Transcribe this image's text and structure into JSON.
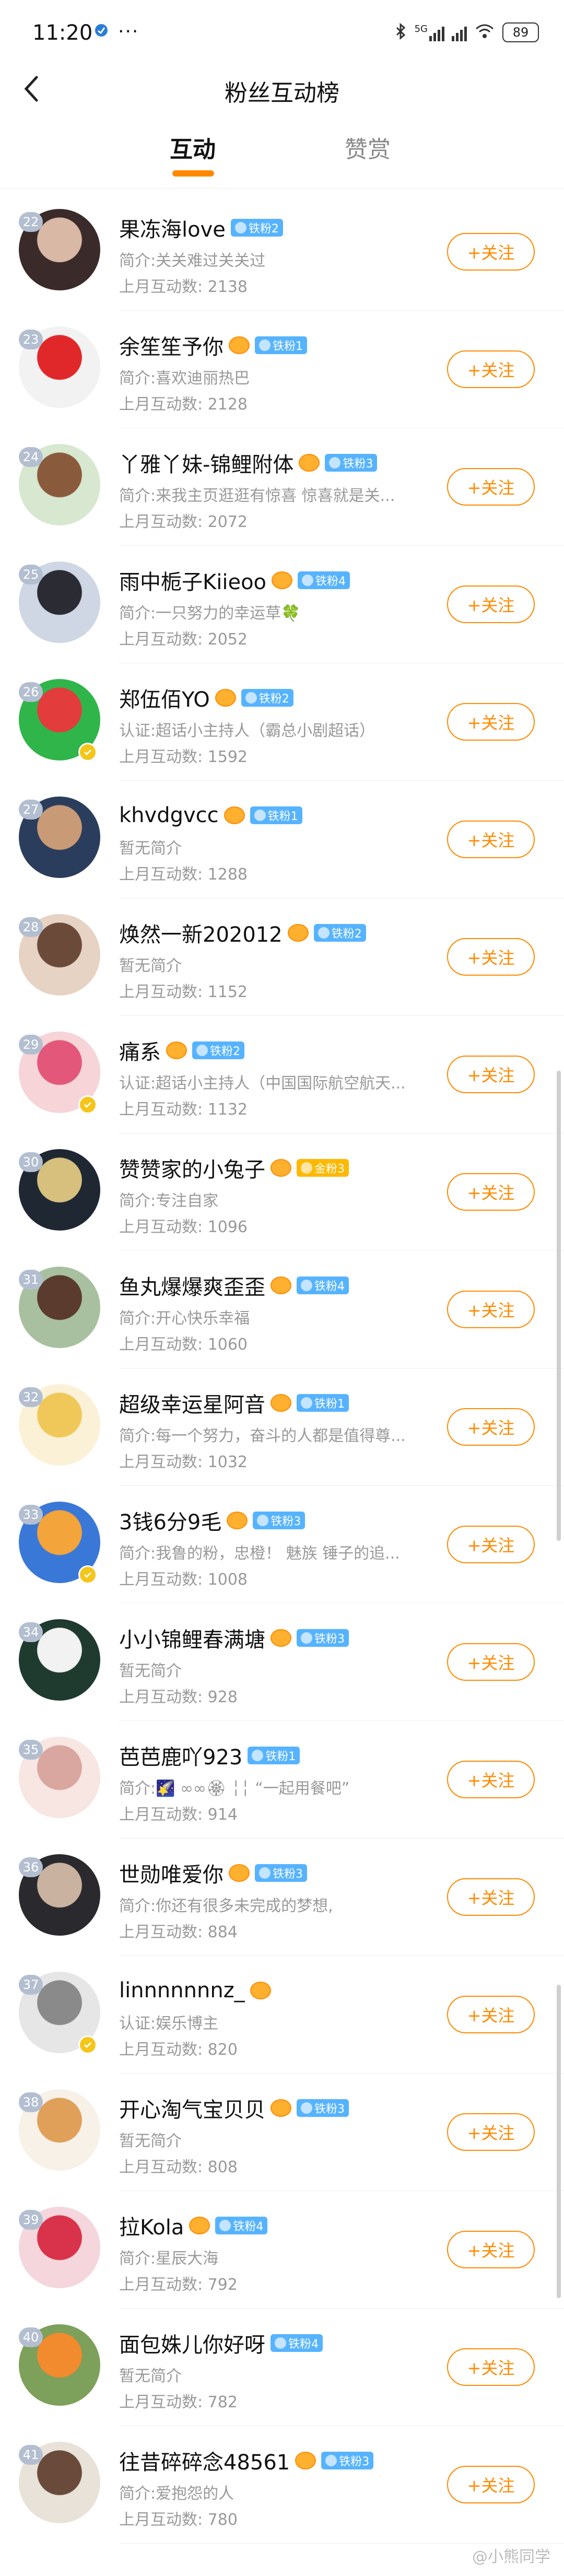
{
  "status_bar": {
    "time": "11:20",
    "dots": "···",
    "battery": "89",
    "network": "5G"
  },
  "header": {
    "title": "粉丝互动榜",
    "back_icon": "chevron-left-icon"
  },
  "tabs": [
    {
      "label": "互动",
      "active": true
    },
    {
      "label": "赞赏",
      "active": false
    }
  ],
  "follow_label": "+关注",
  "fans": [
    {
      "rank": "22",
      "name": "果冻海love",
      "badge": "铁粉2",
      "badge_color": "blue",
      "crown": false,
      "intro": "简介:关关难过关关过",
      "count": "上月互动数: 2138",
      "avatar": [
        "#3a2a2a",
        "#d9b8a6"
      ],
      "verified": false
    },
    {
      "rank": "23",
      "name": "余笙笙予你",
      "badge": "铁粉1",
      "badge_color": "blue",
      "crown": true,
      "intro": "简介:喜欢迪丽热巴",
      "count": "上月互动数: 2128",
      "avatar": [
        "#f2f2f2",
        "#e0282b"
      ],
      "verified": false
    },
    {
      "rank": "24",
      "name": "丫雅丫妹-锦鲤附体",
      "badge": "铁粉3",
      "badge_color": "blue",
      "crown": true,
      "intro": "简介:来我主页逛逛有惊喜 惊喜就是关...",
      "count": "上月互动数: 2072",
      "avatar": [
        "#d7e7d0",
        "#8a5a3c"
      ],
      "verified": false
    },
    {
      "rank": "25",
      "name": "雨中栀子Kiieoo",
      "badge": "铁粉4",
      "badge_color": "blue",
      "crown": true,
      "intro": "简介:一只努力的幸运草🍀",
      "count": "上月互动数: 2052",
      "avatar": [
        "#cfd6e4",
        "#2b2b33"
      ],
      "verified": false
    },
    {
      "rank": "26",
      "name": "郑伍佰YO",
      "badge": "铁粉2",
      "badge_color": "blue",
      "crown": true,
      "intro": "认证:超话小主持人（霸总小剧超话）",
      "count": "上月互动数: 1592",
      "avatar": [
        "#2fb54a",
        "#e23c3c"
      ],
      "verified": true
    },
    {
      "rank": "27",
      "name": "khvdgvcc",
      "badge": "铁粉1",
      "badge_color": "blue",
      "crown": true,
      "intro": "暂无简介",
      "count": "上月互动数: 1288",
      "avatar": [
        "#2b3d5c",
        "#c99a76"
      ],
      "verified": false
    },
    {
      "rank": "28",
      "name": "焕然一新202012",
      "badge": "铁粉2",
      "badge_color": "blue",
      "crown": true,
      "intro": "暂无简介",
      "count": "上月互动数: 1152",
      "avatar": [
        "#e6d3c4",
        "#6b4a3a"
      ],
      "verified": false
    },
    {
      "rank": "29",
      "name": "痛系",
      "badge": "铁粉2",
      "badge_color": "blue",
      "crown": true,
      "intro": "认证:超话小主持人（中国国际航空航天...",
      "count": "上月互动数: 1132",
      "avatar": [
        "#f6d4d8",
        "#e2577a"
      ],
      "verified": true
    },
    {
      "rank": "30",
      "name": "赞赞家的小兔子",
      "badge": "金粉3",
      "badge_color": "gold",
      "crown": true,
      "intro": "简介:专注自家",
      "count": "上月互动数: 1096",
      "avatar": [
        "#1f2733",
        "#d7c07e"
      ],
      "verified": false
    },
    {
      "rank": "31",
      "name": "鱼丸爆爆爽歪歪",
      "badge": "铁粉4",
      "badge_color": "blue",
      "crown": true,
      "intro": "简介:开心快乐幸福",
      "count": "上月互动数: 1060",
      "avatar": [
        "#a8c0a0",
        "#5a3b2e"
      ],
      "verified": false
    },
    {
      "rank": "32",
      "name": "超级幸运星阿音",
      "badge": "铁粉1",
      "badge_color": "blue",
      "crown": true,
      "intro": "简介:每一个努力，奋斗的人都是值得尊...",
      "count": "上月互动数: 1032",
      "avatar": [
        "#fbf1d6",
        "#f0c85a"
      ],
      "verified": false
    },
    {
      "rank": "33",
      "name": "3钱6分9毛",
      "badge": "铁粉3",
      "badge_color": "blue",
      "crown": true,
      "intro": "简介:我鲁的粉，忠橙！ 魅族 锤子的追...",
      "count": "上月互动数: 1008",
      "avatar": [
        "#3a78d8",
        "#f3a43a"
      ],
      "verified": true
    },
    {
      "rank": "34",
      "name": "小小锦鲤春满塘",
      "badge": "铁粉3",
      "badge_color": "blue",
      "crown": true,
      "intro": "暂无简介",
      "count": "上月互动数: 928",
      "avatar": [
        "#1f3a2e",
        "#f2f2f2"
      ],
      "verified": false
    },
    {
      "rank": "35",
      "name": "芭芭鹿吖923",
      "badge": "铁粉1",
      "badge_color": "blue",
      "crown": false,
      "intro": "简介:🌠 ∞∞🏵 ╎╎ “一起用餐吧”",
      "count": "上月互动数: 914",
      "avatar": [
        "#f7e6e2",
        "#d9a6a0"
      ],
      "verified": false
    },
    {
      "rank": "36",
      "name": "世勋唯爱你",
      "badge": "铁粉3",
      "badge_color": "blue",
      "crown": true,
      "intro": "简介:你还有很多未完成的梦想,",
      "count": "上月互动数: 884",
      "avatar": [
        "#2a2a2e",
        "#c9b3a0"
      ],
      "verified": false
    },
    {
      "rank": "37",
      "name": "linnnnnnnz_",
      "badge": "",
      "badge_color": "",
      "crown": true,
      "intro": "认证:娱乐博主",
      "count": "上月互动数: 820",
      "avatar": [
        "#e6e6e6",
        "#8a8a8a"
      ],
      "verified": true
    },
    {
      "rank": "38",
      "name": "开心淘气宝贝贝",
      "badge": "铁粉3",
      "badge_color": "blue",
      "crown": true,
      "intro": "暂无简介",
      "count": "上月互动数: 808",
      "avatar": [
        "#f7f1e8",
        "#e0a05a"
      ],
      "verified": false
    },
    {
      "rank": "39",
      "name": "拉Kola",
      "badge": "铁粉4",
      "badge_color": "blue",
      "crown": true,
      "intro": "简介:星辰大海",
      "count": "上月互动数: 792",
      "avatar": [
        "#f4d6dc",
        "#d8334a"
      ],
      "verified": false
    },
    {
      "rank": "40",
      "name": "面包姝儿你好呀",
      "badge": "铁粉4",
      "badge_color": "blue",
      "crown": false,
      "intro": "暂无简介",
      "count": "上月互动数: 782",
      "avatar": [
        "#7da05a",
        "#f28a2e"
      ],
      "verified": false
    },
    {
      "rank": "41",
      "name": "往昔碎碎念48561",
      "badge": "铁粉3",
      "badge_color": "blue",
      "crown": true,
      "intro": "简介:爱抱怨的人",
      "count": "上月互动数: 780",
      "avatar": [
        "#e9e2d8",
        "#6a4a3a"
      ],
      "verified": false
    }
  ],
  "watermark": "@小熊同学"
}
